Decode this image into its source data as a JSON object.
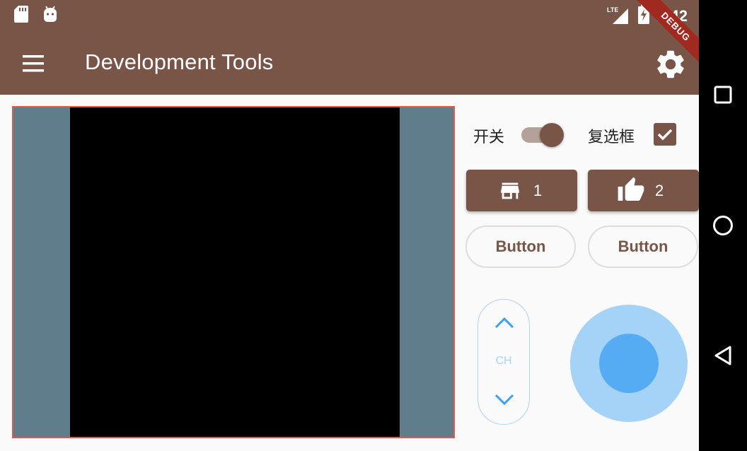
{
  "status_bar": {
    "time": "1:42",
    "network": "LTE",
    "icons": [
      "sd-card-icon",
      "android-debug-icon",
      "lte-signal-icon",
      "battery-charging-icon"
    ]
  },
  "app_bar": {
    "title": "Development Tools",
    "debug_banner": "DEBUG",
    "menu_icon": "hamburger-menu-icon",
    "settings_icon": "gear-icon"
  },
  "controls": {
    "switch": {
      "label": "开关",
      "on": true
    },
    "checkbox": {
      "label": "复选框",
      "checked": true
    },
    "raised_buttons": [
      {
        "icon": "store-icon",
        "label": "1"
      },
      {
        "icon": "thumb-up-icon",
        "label": "2"
      }
    ],
    "outline_buttons": [
      {
        "label": "Button"
      },
      {
        "label": "Button"
      }
    ],
    "channel_stepper": {
      "label": "CH",
      "up_icon": "chevron-up-icon",
      "down_icon": "chevron-down-icon"
    },
    "joystick": {
      "x": 0,
      "y": 0
    }
  },
  "colors": {
    "primary": "#795548",
    "video_bg": "#607d8b",
    "accent_light": "#a5d3f8",
    "accent": "#56acf3",
    "debug_banner": "#a02a20"
  },
  "nav_bar": {
    "icons": [
      "recent-apps-icon",
      "home-icon",
      "back-icon"
    ]
  }
}
